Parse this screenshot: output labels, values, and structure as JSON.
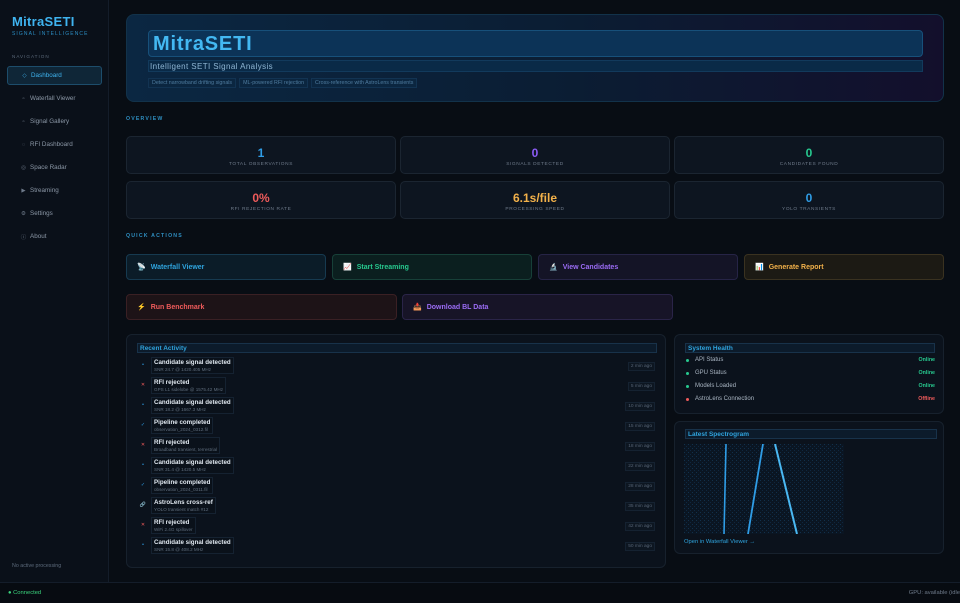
{
  "sidebar": {
    "brand": "MitraSETI",
    "tagline": "SIGNAL INTELLIGENCE",
    "nav_heading": "NAVIGATION",
    "items": [
      {
        "label": "Dashboard",
        "icon": "◇",
        "active": true
      },
      {
        "label": "Waterfall Viewer",
        "icon": "▫"
      },
      {
        "label": "Signal Gallery",
        "icon": "▫"
      },
      {
        "label": "RFI Dashboard",
        "icon": "◌"
      },
      {
        "label": "Space Radar",
        "icon": "◎"
      },
      {
        "label": "Streaming",
        "icon": "▶"
      },
      {
        "label": "Settings",
        "icon": "⚙"
      },
      {
        "label": "About",
        "icon": "ⓘ"
      }
    ],
    "status": "No active processing"
  },
  "statusbar": {
    "connection": "● Connected",
    "gpu": "GPU: available (idle"
  },
  "hero": {
    "title": "MitraSETI",
    "subtitle": "Intelligent SETI Signal Analysis",
    "tags": [
      "Detect narrowband drifting signals",
      "ML-powered RFI rejection",
      "Cross-reference with AstroLens transients"
    ]
  },
  "overview": {
    "label": "OVERVIEW",
    "stats": [
      {
        "value": "1",
        "label": "TOTAL OBSERVATIONS",
        "color": "#2f9de6"
      },
      {
        "value": "0",
        "label": "SIGNALS DETECTED",
        "color": "#8b5cf6"
      },
      {
        "value": "0",
        "label": "CANDIDATES FOUND",
        "color": "#27c98f"
      },
      {
        "value": "0%",
        "label": "RFI REJECTION RATE",
        "color": "#ef5b5b"
      },
      {
        "value": "6.1s/file",
        "label": "PROCESSING SPEED",
        "color": "#f2b14a"
      },
      {
        "value": "0",
        "label": "YOLO TRANSIENTS",
        "color": "#2f9de6"
      }
    ]
  },
  "quick_actions": {
    "label": "QUICK ACTIONS",
    "buttons": [
      {
        "label": "Waterfall Viewer",
        "icon": "📡"
      },
      {
        "label": "Start Streaming",
        "icon": "📈"
      },
      {
        "label": "View Candidates",
        "icon": "🔬"
      },
      {
        "label": "Generate Report",
        "icon": "📊"
      },
      {
        "label": "Run Benchmark",
        "icon": "⚡"
      },
      {
        "label": "Download BL Data",
        "icon": "📥"
      }
    ]
  },
  "activity": {
    "title": "Recent Activity",
    "items": [
      {
        "icon": "•",
        "color": "#2f9de6",
        "title": "Candidate signal detected",
        "detail": "SNR 24.7 @ 1420.405 MHz",
        "time": "2 min ago"
      },
      {
        "icon": "✕",
        "color": "#ef5b5b",
        "title": "RFI rejected",
        "detail": "GPS L1 sidelobe @ 1575.42 MHz",
        "time": "5 min ago"
      },
      {
        "icon": "•",
        "color": "#2f9de6",
        "title": "Candidate signal detected",
        "detail": "SNR 18.2 @ 1667.3 MHz",
        "time": "10 min ago"
      },
      {
        "icon": "✓",
        "color": "#2f9de6",
        "title": "Pipeline completed",
        "detail": "observation_2024_0312.fil",
        "time": "15 min ago"
      },
      {
        "icon": "✕",
        "color": "#ef5b5b",
        "title": "RFI rejected",
        "detail": "Broadband transient, terrestrial",
        "time": "18 min ago"
      },
      {
        "icon": "•",
        "color": "#2f9de6",
        "title": "Candidate signal detected",
        "detail": "SNR 31.4 @ 1420.5 MHz",
        "time": "22 min ago"
      },
      {
        "icon": "✓",
        "color": "#2f9de6",
        "title": "Pipeline completed",
        "detail": "observation_2024_0311.fil",
        "time": "28 min ago"
      },
      {
        "icon": "🔗",
        "color": "#9aa6b4",
        "title": "AstroLens cross-ref",
        "detail": "YOLO transient match #12",
        "time": "35 min ago"
      },
      {
        "icon": "✕",
        "color": "#ef5b5b",
        "title": "RFI rejected",
        "detail": "WiFi 2.4G spillover",
        "time": "42 min ago"
      },
      {
        "icon": "•",
        "color": "#2f9de6",
        "title": "Candidate signal detected",
        "detail": "SNR 15.8 @ 408.2 MHz",
        "time": "50 min ago"
      }
    ]
  },
  "health": {
    "title": "System Health",
    "items": [
      {
        "name": "API Status",
        "value": "Online",
        "color": "#27c98f"
      },
      {
        "name": "GPU Status",
        "value": "Online",
        "color": "#27c98f"
      },
      {
        "name": "Models Loaded",
        "value": "Online",
        "color": "#27c98f"
      },
      {
        "name": "AstroLens Connection",
        "value": "Offline",
        "color": "#ef5b5b"
      }
    ]
  },
  "spectrogram": {
    "title": "Latest Spectrogram",
    "link": "Open in Waterfall Viewer →"
  }
}
